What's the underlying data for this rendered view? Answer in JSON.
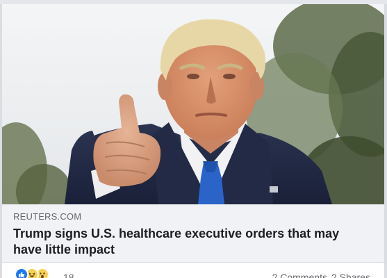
{
  "link_preview": {
    "domain": "REUTERS.COM",
    "headline": "Trump signs U.S. healthcare executive orders that may have little impact"
  },
  "engagement": {
    "reaction_icons": [
      "like-icon",
      "haha-icon",
      "wow-icon"
    ],
    "reaction_count": "18",
    "comments": "2 Comments",
    "shares": "2 Shares"
  },
  "colors": {
    "link_preview_bg": "#f0f2f5",
    "like_blue": "#1877f2",
    "secondary_text": "#65676b",
    "headline_text": "#1c1e21"
  }
}
